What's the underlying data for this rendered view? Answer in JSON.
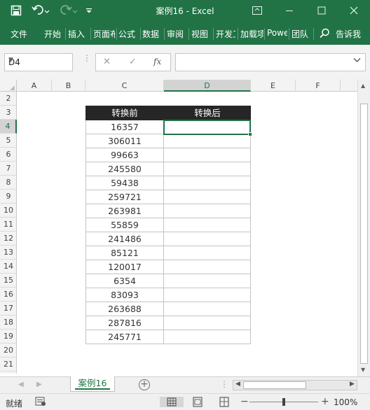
{
  "window": {
    "title": "案例16  -  Excel",
    "minimize_icon": "minimize-icon",
    "restore_icon": "restore-icon",
    "close_icon": "close-icon"
  },
  "ribbon": {
    "tabs": [
      "文件",
      "开始",
      "插入",
      "页面布局",
      "公式",
      "数据",
      "审阅",
      "视图",
      "开发工具",
      "加载项",
      "Power Pivot",
      "团队"
    ],
    "tell_me": "告诉我"
  },
  "formula_bar": {
    "name_box": "D4",
    "fx_label": "fx",
    "value": ""
  },
  "columns": [
    "A",
    "B",
    "C",
    "D",
    "E",
    "F"
  ],
  "selected_column": "D",
  "rows": [
    "2",
    "3",
    "4",
    "5",
    "6",
    "7",
    "8",
    "9",
    "10",
    "11",
    "12",
    "13",
    "14",
    "15",
    "16",
    "17",
    "18",
    "19",
    "20",
    "21"
  ],
  "selected_row": "4",
  "table": {
    "header_before": "转换前",
    "header_after": "转换后",
    "before": [
      "16357",
      "306011",
      "99663",
      "245580",
      "59438",
      "259721",
      "263981",
      "55859",
      "241486",
      "85121",
      "120017",
      "6354",
      "83093",
      "263688",
      "287816",
      "245771"
    ],
    "after": [
      "",
      "",
      "",
      "",
      "",
      "",
      "",
      "",
      "",
      "",
      "",
      "",
      "",
      "",
      "",
      ""
    ]
  },
  "sheet_tabs": [
    "案例16"
  ],
  "status": {
    "ready": "就绪",
    "zoom": "100%"
  },
  "colors": {
    "accent": "#217346",
    "header_fill": "#262626"
  }
}
